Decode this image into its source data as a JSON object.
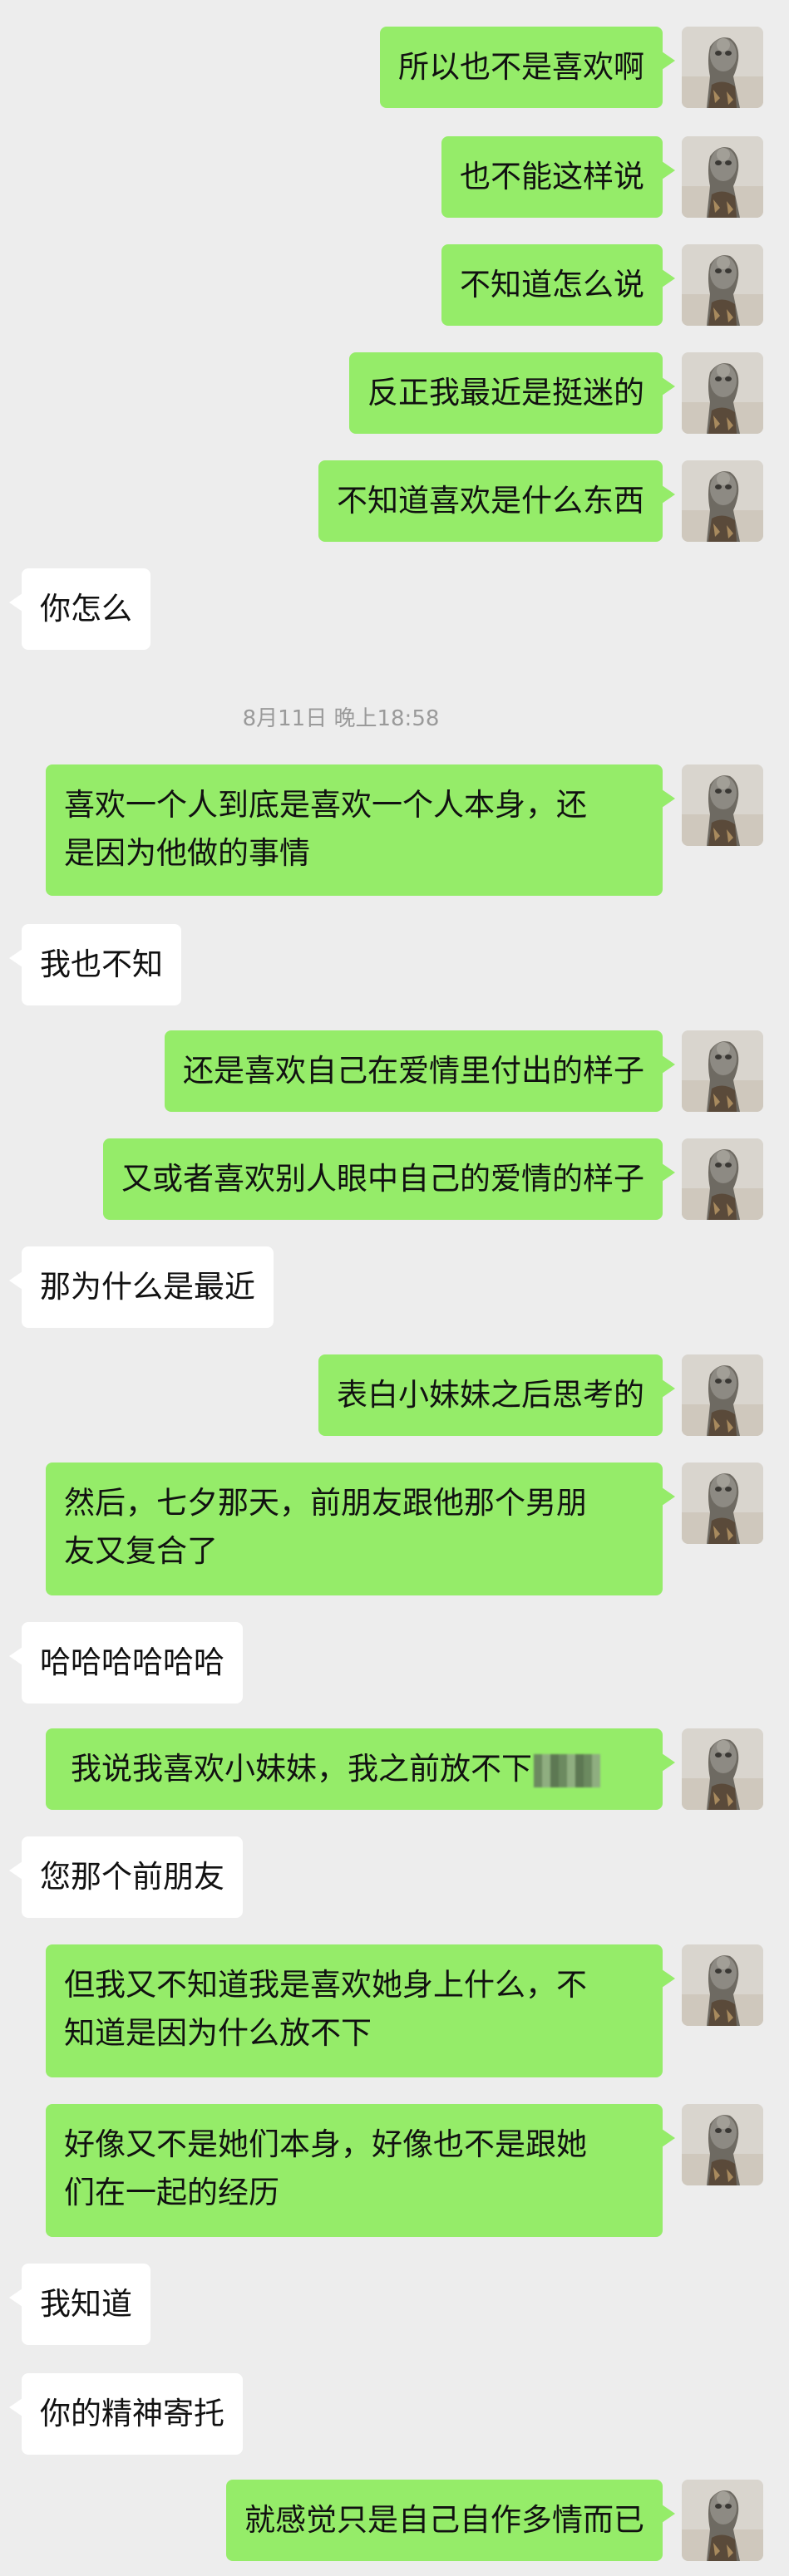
{
  "chat": {
    "timestamp": "8月11日 晚上18:58",
    "messages": [
      {
        "id": "m1",
        "side": "me",
        "text": "所以也不是喜欢啊"
      },
      {
        "id": "m2",
        "side": "me",
        "text": "也不能这样说"
      },
      {
        "id": "m3",
        "side": "me",
        "text": "不知道怎么说"
      },
      {
        "id": "m4",
        "side": "me",
        "text": "反正我最近是挺迷的"
      },
      {
        "id": "m5",
        "side": "me",
        "text": "不知道喜欢是什么东西"
      },
      {
        "id": "m6",
        "side": "them",
        "text": "你怎么"
      },
      {
        "id": "m7",
        "side": "me",
        "text": "喜欢一个人到底是喜欢一个人本身，还\n是因为他做的事情"
      },
      {
        "id": "m8",
        "side": "them",
        "text": "我也不知"
      },
      {
        "id": "m9",
        "side": "me",
        "text": "还是喜欢自己在爱情里付出的样子"
      },
      {
        "id": "m10",
        "side": "me",
        "text": "又或者喜欢别人眼中自己的爱情的样子"
      },
      {
        "id": "m11",
        "side": "them",
        "text": "那为什么是最近"
      },
      {
        "id": "m12",
        "side": "me",
        "text": "表白小妹妹之后思考的"
      },
      {
        "id": "m13",
        "side": "me",
        "text": "然后，七夕那天，前朋友跟他那个男朋\n友又复合了"
      },
      {
        "id": "m14",
        "side": "them",
        "text": "哈哈哈哈哈哈"
      },
      {
        "id": "m15",
        "side": "me",
        "text": "我说我喜欢小妹妹，我之前放不下"
      },
      {
        "id": "m16",
        "side": "them",
        "text": "您那个前朋友"
      },
      {
        "id": "m17",
        "side": "me",
        "text": "但我又不知道我是喜欢她身上什么，不\n知道是因为什么放不下"
      },
      {
        "id": "m18",
        "side": "me",
        "text": "好像又不是她们本身，好像也不是跟她\n们在一起的经历"
      },
      {
        "id": "m19",
        "side": "them",
        "text": "我知道"
      },
      {
        "id": "m20",
        "side": "them",
        "text": "你的精神寄托"
      },
      {
        "id": "m21",
        "side": "me",
        "text": "就感觉只是自己自作多情而已"
      }
    ]
  }
}
